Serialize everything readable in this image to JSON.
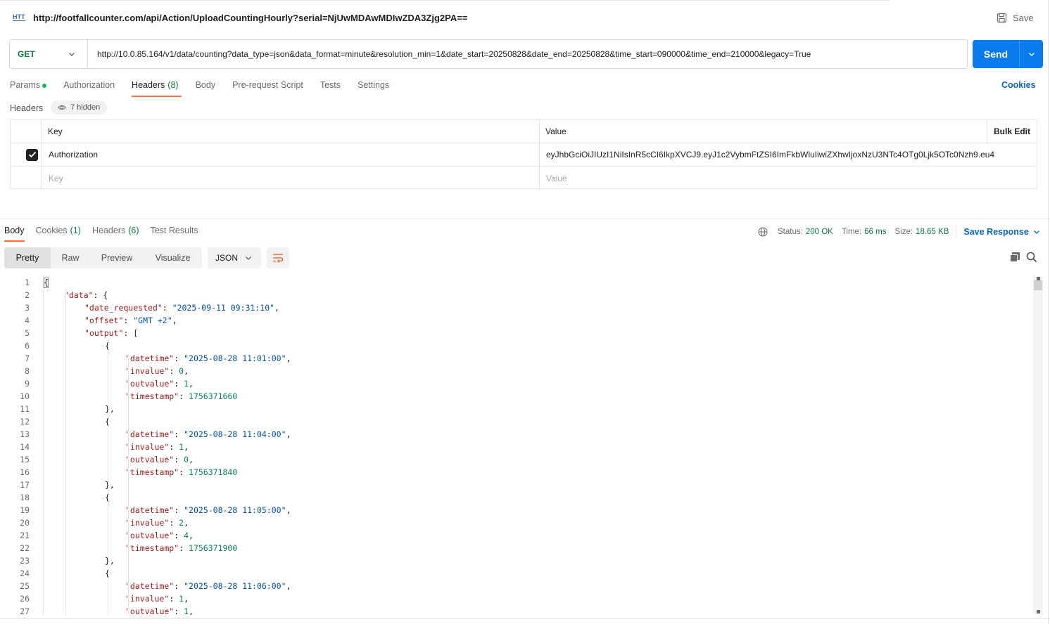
{
  "request": {
    "title": "http://footfallcounter.com/api/Action/UploadCountingHourly?serial=NjUwMDAwMDIwZDA3Zjg2PA==",
    "save_label": "Save",
    "method": "GET",
    "url": "http://10.0.85.164/v1/data/counting?data_type=json&data_format=minute&resolution_min=1&date_start=20250828&date_end=20250828&time_start=090000&time_end=210000&legacy=True",
    "send_label": "Send"
  },
  "request_tabs": {
    "params": "Params",
    "authorization": "Authorization",
    "headers": "Headers",
    "headers_count": "(8)",
    "body": "Body",
    "prerequest": "Pre-request Script",
    "tests": "Tests",
    "settings": "Settings",
    "cookies": "Cookies"
  },
  "headers_section": {
    "label": "Headers",
    "hidden": "7 hidden",
    "col_key": "Key",
    "col_value": "Value",
    "bulk_edit": "Bulk Edit",
    "rows": [
      {
        "key": "Authorization",
        "value": "eyJhbGciOiJIUzI1NiIsInR5cCI6IkpXVCJ9.eyJ1c2VybmFtZSI6ImFkbWluIiwiZXhwIjoxNzU3NTc4OTg0Ljk5OTc0Nzh9.eu4",
        "checked": true
      }
    ],
    "placeholder_key": "Key",
    "placeholder_value": "Value"
  },
  "response_tabs": {
    "body": "Body",
    "cookies": "Cookies",
    "cookies_count": "(1)",
    "headers": "Headers",
    "headers_count": "(6)",
    "test_results": "Test Results"
  },
  "response_meta": {
    "status_label": "Status:",
    "status_value": "200 OK",
    "time_label": "Time:",
    "time_value": "66 ms",
    "size_label": "Size:",
    "size_value": "18.65 KB",
    "save_response": "Save Response"
  },
  "view_modes": [
    "Pretty",
    "Raw",
    "Preview",
    "Visualize"
  ],
  "format": "JSON",
  "code_lines": [
    {
      "n": "1",
      "indent": 0,
      "parts": [
        [
          "p",
          "{"
        ]
      ]
    },
    {
      "n": "2",
      "indent": 1,
      "parts": [
        [
          "k",
          "\"data\""
        ],
        [
          "p",
          ": {"
        ]
      ]
    },
    {
      "n": "3",
      "indent": 2,
      "parts": [
        [
          "k",
          "\"date_requested\""
        ],
        [
          "p",
          ": "
        ],
        [
          "s",
          "\"2025-09-11 09:31:10\""
        ],
        [
          "p",
          ","
        ]
      ]
    },
    {
      "n": "4",
      "indent": 2,
      "parts": [
        [
          "k",
          "\"offset\""
        ],
        [
          "p",
          ": "
        ],
        [
          "s",
          "\"GMT +2\""
        ],
        [
          "p",
          ","
        ]
      ]
    },
    {
      "n": "5",
      "indent": 2,
      "parts": [
        [
          "k",
          "\"output\""
        ],
        [
          "p",
          ": ["
        ]
      ]
    },
    {
      "n": "6",
      "indent": 3,
      "parts": [
        [
          "p",
          "{"
        ]
      ]
    },
    {
      "n": "7",
      "indent": 4,
      "parts": [
        [
          "k",
          "\"datetime\""
        ],
        [
          "p",
          ": "
        ],
        [
          "s",
          "\"2025-08-28 11:01:00\""
        ],
        [
          "p",
          ","
        ]
      ]
    },
    {
      "n": "8",
      "indent": 4,
      "parts": [
        [
          "k",
          "\"invalue\""
        ],
        [
          "p",
          ": "
        ],
        [
          "n",
          "0"
        ],
        [
          "p",
          ","
        ]
      ]
    },
    {
      "n": "9",
      "indent": 4,
      "parts": [
        [
          "k",
          "\"outvalue\""
        ],
        [
          "p",
          ": "
        ],
        [
          "n",
          "1"
        ],
        [
          "p",
          ","
        ]
      ]
    },
    {
      "n": "10",
      "indent": 4,
      "parts": [
        [
          "k",
          "\"timestamp\""
        ],
        [
          "p",
          ": "
        ],
        [
          "n",
          "1756371660"
        ]
      ]
    },
    {
      "n": "11",
      "indent": 3,
      "parts": [
        [
          "p",
          "},"
        ]
      ]
    },
    {
      "n": "12",
      "indent": 3,
      "parts": [
        [
          "p",
          "{"
        ]
      ]
    },
    {
      "n": "13",
      "indent": 4,
      "parts": [
        [
          "k",
          "\"datetime\""
        ],
        [
          "p",
          ": "
        ],
        [
          "s",
          "\"2025-08-28 11:04:00\""
        ],
        [
          "p",
          ","
        ]
      ]
    },
    {
      "n": "14",
      "indent": 4,
      "parts": [
        [
          "k",
          "\"invalue\""
        ],
        [
          "p",
          ": "
        ],
        [
          "n",
          "1"
        ],
        [
          "p",
          ","
        ]
      ]
    },
    {
      "n": "15",
      "indent": 4,
      "parts": [
        [
          "k",
          "\"outvalue\""
        ],
        [
          "p",
          ": "
        ],
        [
          "n",
          "0"
        ],
        [
          "p",
          ","
        ]
      ]
    },
    {
      "n": "16",
      "indent": 4,
      "parts": [
        [
          "k",
          "\"timestamp\""
        ],
        [
          "p",
          ": "
        ],
        [
          "n",
          "1756371840"
        ]
      ]
    },
    {
      "n": "17",
      "indent": 3,
      "parts": [
        [
          "p",
          "},"
        ]
      ]
    },
    {
      "n": "18",
      "indent": 3,
      "parts": [
        [
          "p",
          "{"
        ]
      ]
    },
    {
      "n": "19",
      "indent": 4,
      "parts": [
        [
          "k",
          "\"datetime\""
        ],
        [
          "p",
          ": "
        ],
        [
          "s",
          "\"2025-08-28 11:05:00\""
        ],
        [
          "p",
          ","
        ]
      ]
    },
    {
      "n": "20",
      "indent": 4,
      "parts": [
        [
          "k",
          "\"invalue\""
        ],
        [
          "p",
          ": "
        ],
        [
          "n",
          "2"
        ],
        [
          "p",
          ","
        ]
      ]
    },
    {
      "n": "21",
      "indent": 4,
      "parts": [
        [
          "k",
          "\"outvalue\""
        ],
        [
          "p",
          ": "
        ],
        [
          "n",
          "4"
        ],
        [
          "p",
          ","
        ]
      ]
    },
    {
      "n": "22",
      "indent": 4,
      "parts": [
        [
          "k",
          "\"timestamp\""
        ],
        [
          "p",
          ": "
        ],
        [
          "n",
          "1756371900"
        ]
      ]
    },
    {
      "n": "23",
      "indent": 3,
      "parts": [
        [
          "p",
          "},"
        ]
      ]
    },
    {
      "n": "24",
      "indent": 3,
      "parts": [
        [
          "p",
          "{"
        ]
      ]
    },
    {
      "n": "25",
      "indent": 4,
      "parts": [
        [
          "k",
          "\"datetime\""
        ],
        [
          "p",
          ": "
        ],
        [
          "s",
          "\"2025-08-28 11:06:00\""
        ],
        [
          "p",
          ","
        ]
      ]
    },
    {
      "n": "26",
      "indent": 4,
      "parts": [
        [
          "k",
          "\"invalue\""
        ],
        [
          "p",
          ": "
        ],
        [
          "n",
          "1"
        ],
        [
          "p",
          ","
        ]
      ]
    },
    {
      "n": "27",
      "indent": 4,
      "parts": [
        [
          "k",
          "\"outvalue\""
        ],
        [
          "p",
          ": "
        ],
        [
          "n",
          "1"
        ],
        [
          "p",
          ","
        ]
      ]
    }
  ],
  "colors": {
    "accent": "#ff6c37",
    "send": "#097bed",
    "link": "#0a66c2",
    "success": "#0f7b3f"
  },
  "icons": {
    "http": "http-icon",
    "save": "save-icon",
    "globe": "globe-icon",
    "wrap": "wrap-lines-icon",
    "copy": "copy-icon",
    "search": "search-icon"
  }
}
